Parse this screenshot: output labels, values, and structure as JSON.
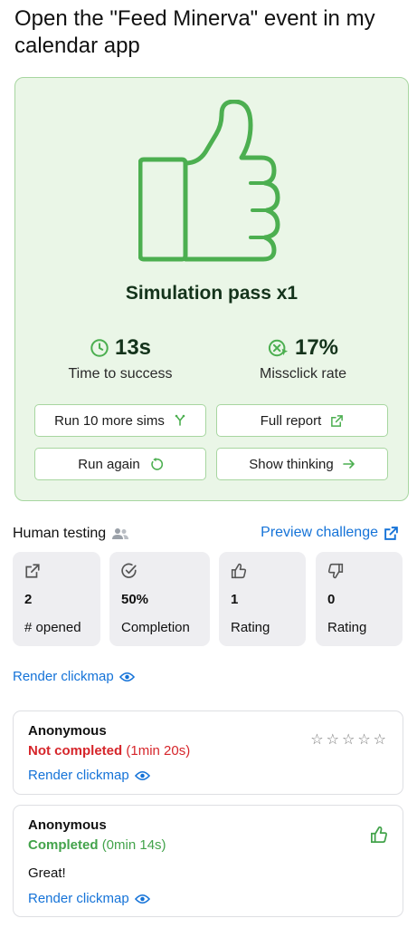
{
  "task": {
    "title": "Open the \"Feed Minerva\" event in my calendar app"
  },
  "simulation": {
    "title": "Simulation pass x1",
    "time_value": "13s",
    "time_label": "Time to success",
    "misclick_value": "17%",
    "misclick_label": "Missclick rate",
    "buttons": {
      "run_more": "Run 10 more sims",
      "full_report": "Full report",
      "run_again": "Run again",
      "show_thinking": "Show thinking"
    },
    "colors": {
      "accent": "#4caf50",
      "card_bg": "#eaf6e7",
      "border": "#a7d6a0"
    }
  },
  "human_testing": {
    "title": "Human testing",
    "preview_label": "Preview challenge",
    "stats": [
      {
        "icon": "external-link-icon",
        "value": "2",
        "label": "# opened"
      },
      {
        "icon": "check-circle-icon",
        "value": "50%",
        "label": "Completion"
      },
      {
        "icon": "thumbs-up-icon",
        "value": "1",
        "label": "Rating"
      },
      {
        "icon": "thumbs-down-icon",
        "value": "0",
        "label": "Rating"
      }
    ],
    "render_clickmap": "Render clickmap",
    "responses": [
      {
        "name": "Anonymous",
        "status": "Not completed",
        "duration": "(1min 20s)",
        "render_label": "Render clickmap",
        "stars": "☆"
      },
      {
        "name": "Anonymous",
        "status": "Completed",
        "duration": "(0min 14s)",
        "comment": "Great!",
        "render_label": "Render clickmap"
      }
    ]
  }
}
